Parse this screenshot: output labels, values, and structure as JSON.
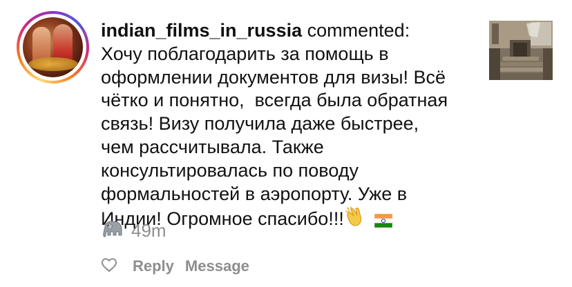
{
  "comment": {
    "username": "indian_films_in_russia",
    "action": "commented:",
    "body_lines": [
      "Хочу поблагодарить за помощь в",
      "оформлении документов для визы! Всё",
      "чётко и понятно,  всегда была обратная",
      "связь! Визу получила даже быстрее,",
      "чем рассчитывала. Также",
      "консультировалась по поводу",
      "формальностей в аэропорту. Уже в",
      "Индии! Огромное спасибо!!!"
    ],
    "time": "49m"
  },
  "actions": {
    "reply_label": "Reply",
    "message_label": "Message"
  },
  "icons": {
    "avatar": "avatar-story-ring",
    "clapping": "clapping-hands-emoji",
    "flag": "india-flag-emoji",
    "elephant": "elephant-emoji",
    "heart": "heart-outline-icon",
    "thumbnail": "post-thumbnail"
  },
  "colors": {
    "text": "#111111",
    "muted": "#8e8e8e",
    "story_ring": [
      "#feda75",
      "#fa7e1e",
      "#d62976",
      "#962fbf",
      "#4f5bd5"
    ]
  }
}
